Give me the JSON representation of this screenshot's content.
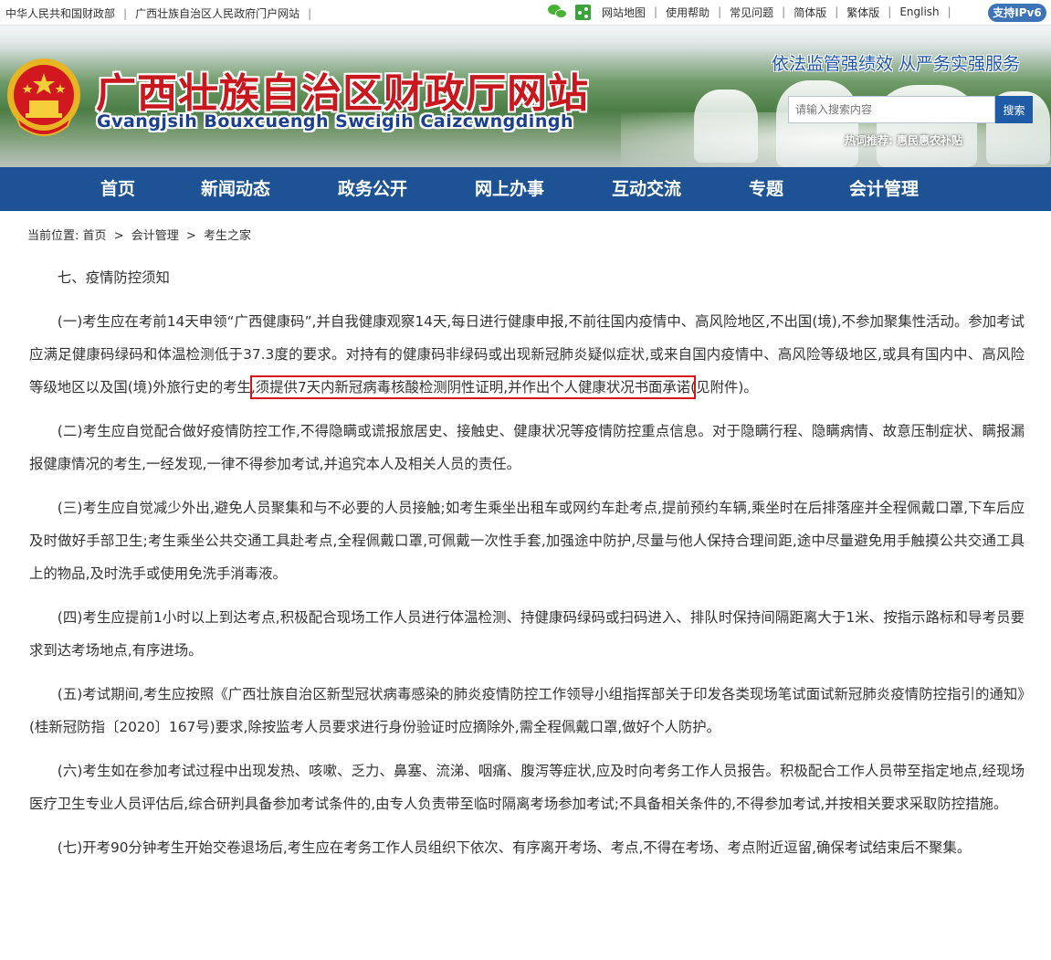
{
  "topbar": {
    "links_left": [
      "中华人民共和国财政部",
      "广西壮族自治区人民政府门户网站"
    ],
    "links_right": [
      "网站地图",
      "使用帮助",
      "常见问题",
      "简体版",
      "繁体版",
      "English"
    ],
    "ipv6": "支持IPv6"
  },
  "banner": {
    "title": "广西壮族自治区财政厅网站",
    "subtitle": "Gvangjsih Bouxcuengh Swcigih Caizcwngdingh",
    "slogan": "依法监管强绩效 从严务实强服务",
    "search_placeholder": "请输入搜索内容",
    "search_button": "搜索",
    "hotwords": "热词推荐: 惠民惠农补贴"
  },
  "nav": {
    "items": [
      "首页",
      "新闻动态",
      "政务公开",
      "网上办事",
      "互动交流",
      "专题",
      "会计管理"
    ]
  },
  "breadcrumb": {
    "label": "当前位置:",
    "items": [
      "首页",
      "会计管理",
      "考生之家"
    ],
    "separator": ">"
  },
  "article": {
    "section_title": "七、疫情防控须知",
    "p1_a": "(一)考生应在考前14天申领“广西健康码”,并自我健康观察14天,每日进行健康申报,不前往国内疫情中、高风险地区,不出国(境),不参加聚集性活动。参加考试应满足健康码绿码和体温检测低于37.3度的要求。对持有的健康码非绿码或出现新冠肺炎疑似症状,或来自国内疫情中、高风险等级地区,或具有国内中、高风险等级地区以及国(境)外旅行史的考生,",
    "p1_highlight": "须提供7天内新冠病毒核酸检测阴性证明,并作出个人健康状况书面承诺",
    "p1_b": "(见附件)。",
    "p2": "(二)考生应自觉配合做好疫情防控工作,不得隐瞒或谎报旅居史、接触史、健康状况等疫情防控重点信息。对于隐瞒行程、隐瞒病情、故意压制症状、瞒报漏报健康情况的考生,一经发现,一律不得参加考试,并追究本人及相关人员的责任。",
    "p3": "(三)考生应自觉减少外出,避免人员聚集和与不必要的人员接触;如考生乘坐出租车或网约车赴考点,提前预约车辆,乘坐时在后排落座并全程佩戴口罩,下车后应及时做好手部卫生;考生乘坐公共交通工具赴考点,全程佩戴口罩,可佩戴一次性手套,加强途中防护,尽量与他人保持合理间距,途中尽量避免用手触摸公共交通工具上的物品,及时洗手或使用免洗手消毒液。",
    "p4": "(四)考生应提前1小时以上到达考点,积极配合现场工作人员进行体温检测、持健康码绿码或扫码进入、排队时保持间隔距离大于1米、按指示路标和导考员要求到达考场地点,有序进场。",
    "p5": "(五)考试期间,考生应按照《广西壮族自治区新型冠状病毒感染的肺炎疫情防控工作领导小组指挥部关于印发各类现场笔试面试新冠肺炎疫情防控指引的通知》(桂新冠防指〔2020〕167号)要求,除按监考人员要求进行身份验证时应摘除外,需全程佩戴口罩,做好个人防护。",
    "p6": "(六)考生如在参加考试过程中出现发热、咳嗽、乏力、鼻塞、流涕、咽痛、腹泻等症状,应及时向考务工作人员报告。积极配合工作人员带至指定地点,经现场医疗卫生专业人员评估后,综合研判具备参加考试条件的,由专人负责带至临时隔离考场参加考试;不具备相关条件的,不得参加考试,并按相关要求采取防控措施。",
    "p7": "(七)开考90分钟考生开始交卷退场后,考生应在考务工作人员组织下依次、有序离开考场、考点,不得在考场、考点附近逗留,确保考试结束后不聚集。"
  },
  "colors": {
    "nav_bg": "#1d5394",
    "title_red": "#c8181e",
    "highlight_border": "#d8141b"
  }
}
